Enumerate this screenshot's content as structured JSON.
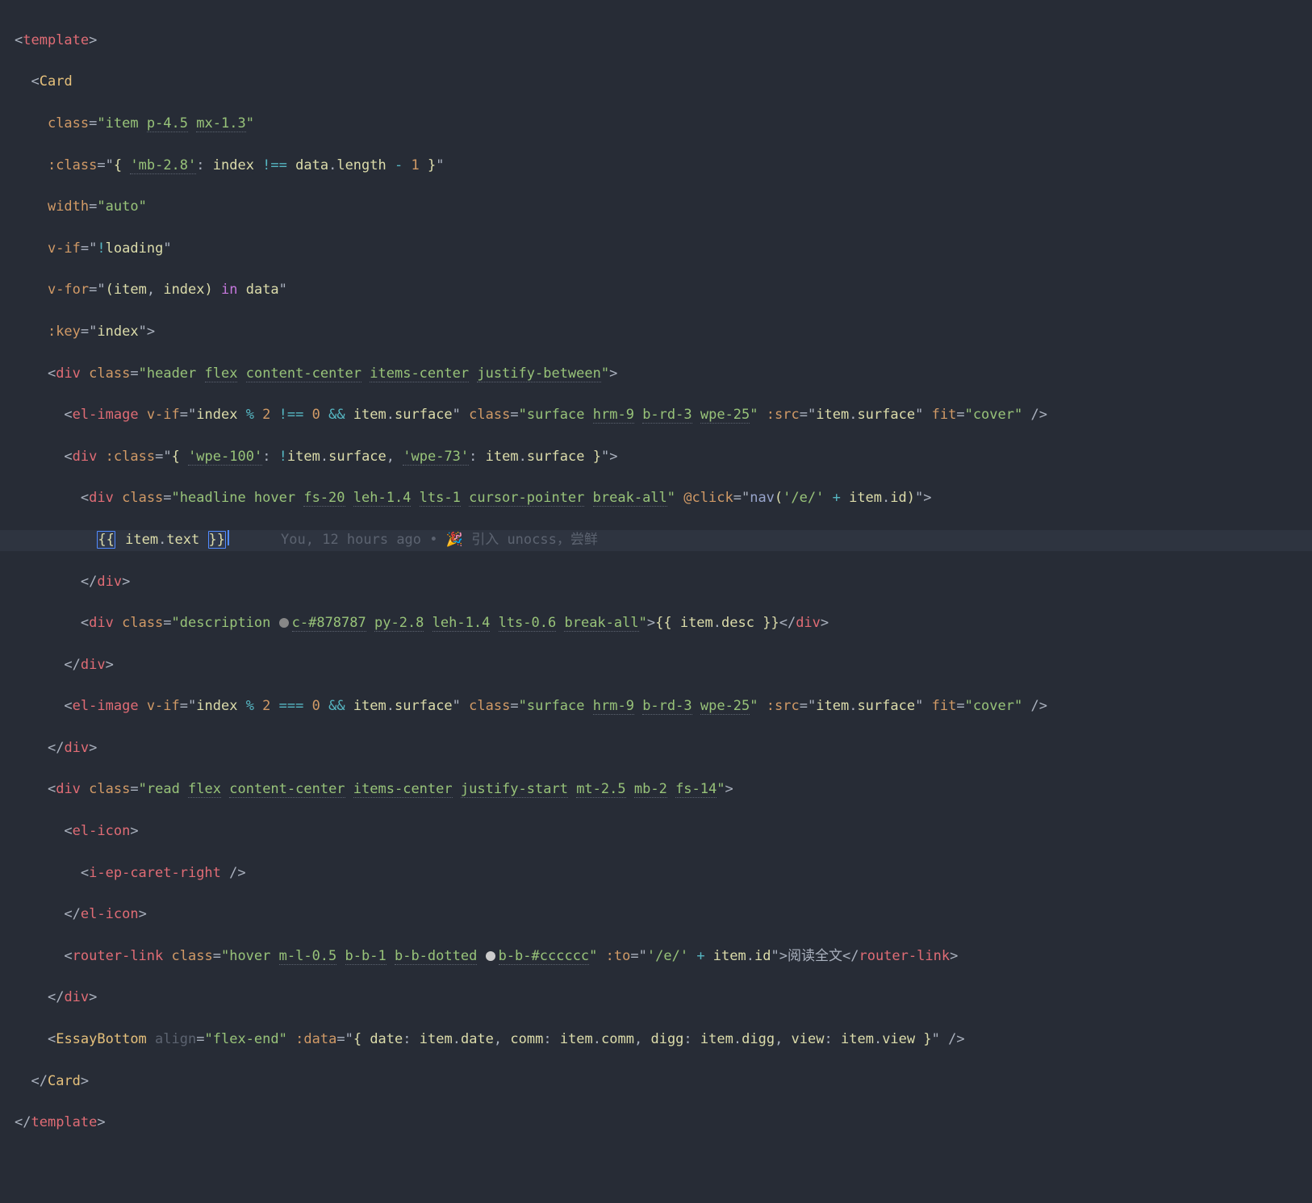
{
  "blame": {
    "author": "You",
    "when": "12 hours ago",
    "sep": "•",
    "msg": "引入 unocss，尝鲜"
  },
  "lines": {
    "l1": {
      "tag": "template"
    },
    "l2": {
      "tag": "Card"
    },
    "l3": {
      "attr": "class",
      "eq": "=",
      "q1": "\"",
      "v": "item ",
      "u1": "p-4.5",
      "sp": " ",
      "u2": "mx-1.3",
      "q2": "\""
    },
    "l4": {
      "attr": ":class",
      "eq": "=",
      "q1": "\"",
      "b1": "{",
      "sp1": " ",
      "s": "'mb-2.8'",
      "c1": ": ",
      "id": "index",
      "op": " !== ",
      "p1": "data",
      "d1": ".",
      "p2": "length",
      "op2": " - ",
      "n": "1",
      "sp2": " ",
      "b2": "}",
      "q2": "\""
    },
    "l5": {
      "attr": "width",
      "eq": "=",
      "q1": "\"",
      "v": "auto",
      "q2": "\""
    },
    "l6": {
      "attr": "v-if",
      "eq": "=",
      "q1": "\"",
      "op": "!",
      "id": "loading",
      "q2": "\""
    },
    "l7": {
      "attr": "v-for",
      "eq": "=",
      "q1": "\"",
      "p1": "(",
      "id1": "item",
      "c1": ", ",
      "id2": "index",
      "p2": ")",
      "kw": " in ",
      "id3": "data",
      "q2": "\""
    },
    "l8": {
      "attr": ":key",
      "eq": "=",
      "q1": "\"",
      "v": "index",
      "q2": "\"",
      "gt": ">"
    },
    "l9": {
      "tag": "div",
      "attr": "class",
      "eq": "=",
      "q1": "\"",
      "v": "header ",
      "u1": "flex",
      "sp1": " ",
      "u2": "content-center",
      "sp2": " ",
      "u3": "items-center",
      "sp3": " ",
      "u4": "justify-between",
      "q2": "\"",
      "gt": ">"
    },
    "l10": {
      "tag": "el-image",
      "a1": "v-if",
      "eq1": "=",
      "q1": "\"",
      "id1": "index",
      "op1": " % ",
      "n1": "2",
      "op2": " !== ",
      "n2": "0",
      "op3": " && ",
      "id2": "item",
      "d1": ".",
      "p1": "surface",
      "q2": "\"",
      "a2": "class",
      "eq2": "=",
      "q3": "\"",
      "v": "surface ",
      "u1": "hrm-9",
      "sp1": " ",
      "u2": "b-rd-3",
      "sp2": " ",
      "u3": "wpe-25",
      "q4": "\"",
      "a3": ":src",
      "eq3": "=",
      "q5": "\"",
      "id3": "item",
      "d2": ".",
      "p2": "surface",
      "q6": "\"",
      "a4": "fit",
      "eq4": "=",
      "q7": "\"",
      "v2": "cover",
      "q8": "\"",
      "slash": " />"
    },
    "l11": {
      "tag": "div",
      "a1": ":class",
      "eq1": "=",
      "q1": "\"",
      "b1": "{",
      "sp1": " ",
      "s1": "'wpe-100'",
      "c1": ": ",
      "op1": "!",
      "id1": "item",
      "d1": ".",
      "p1": "surface",
      "cm": ", ",
      "s2": "'wpe-73'",
      "c2": ": ",
      "id2": "item",
      "d2": ".",
      "p2": "surface",
      "sp2": " ",
      "b2": "}",
      "q2": "\"",
      "gt": ">"
    },
    "l12": {
      "tag": "div",
      "a1": "class",
      "eq1": "=",
      "q1": "\"",
      "v": "headline hover ",
      "u1": "fs-20",
      "sp1": " ",
      "u2": "leh-1.4",
      "sp2": " ",
      "u3": "lts-1",
      "sp3": " ",
      "u4": "cursor-pointer",
      "sp4": " ",
      "u5": "break-all",
      "q2": "\"",
      "a2": "@click",
      "eq2": "=",
      "q3": "\"",
      "fn": "nav",
      "p1": "(",
      "s1": "'/e/'",
      "op1": " + ",
      "id1": "item",
      "d1": ".",
      "pr1": "id",
      "p2": ")",
      "q4": "\"",
      "gt": ">"
    },
    "l13": {
      "mo": "{{",
      "sp1": " ",
      "id": "item",
      "d": ".",
      "p": "text",
      "sp2": " ",
      "mc": "}}"
    },
    "l14": {
      "ctag": "div"
    },
    "l15": {
      "tag": "div",
      "a1": "class",
      "eq1": "=",
      "q1": "\"",
      "v": "description ",
      "color": "c-#878787",
      "sp1": " ",
      "u1": "py-2.8",
      "sp2": " ",
      "u2": "leh-1.4",
      "sp3": " ",
      "u3": "lts-0.6",
      "sp4": " ",
      "u4": "break-all",
      "q2": "\"",
      "gt": ">",
      "mo": "{{ ",
      "id": "item",
      "d": ".",
      "p": "desc",
      "mc": " }}",
      "ctag": "div"
    },
    "l16": {
      "ctag": "div"
    },
    "l17": {
      "tag": "el-image",
      "a1": "v-if",
      "eq1": "=",
      "q1": "\"",
      "id1": "index",
      "op1": " % ",
      "n1": "2",
      "op2": " === ",
      "n2": "0",
      "op3": " && ",
      "id2": "item",
      "d1": ".",
      "p1": "surface",
      "q2": "\"",
      "a2": "class",
      "eq2": "=",
      "q3": "\"",
      "v": "surface ",
      "u1": "hrm-9",
      "sp1": " ",
      "u2": "b-rd-3",
      "sp2": " ",
      "u3": "wpe-25",
      "q4": "\"",
      "a3": ":src",
      "eq3": "=",
      "q5": "\"",
      "id3": "item",
      "d2": ".",
      "p2": "surface",
      "q6": "\"",
      "a4": "fit",
      "eq4": "=",
      "q7": "\"",
      "v2": "cover",
      "q8": "\"",
      "slash": " />"
    },
    "l18": {
      "ctag": "div"
    },
    "l19": {
      "tag": "div",
      "a1": "class",
      "eq1": "=",
      "q1": "\"",
      "v": "read ",
      "u1": "flex",
      "sp1": " ",
      "u2": "content-center",
      "sp2": " ",
      "u3": "items-center",
      "sp3": " ",
      "u4": "justify-start",
      "sp4": " ",
      "u5": "mt-2.5",
      "sp5": " ",
      "u6": "mb-2",
      "sp6": " ",
      "u7": "fs-14",
      "q2": "\"",
      "gt": ">"
    },
    "l20": {
      "tag": "el-icon",
      "gt": ">"
    },
    "l21": {
      "tag": "i-ep-caret-right",
      "slash": " />"
    },
    "l22": {
      "ctag": "el-icon"
    },
    "l23": {
      "tag": "router-link",
      "a1": "class",
      "eq1": "=",
      "q1": "\"",
      "v": "hover ",
      "u1": "m-l-0.5",
      "sp1": " ",
      "u2": "b-b-1",
      "sp2": " ",
      "u3": "b-b-dotted",
      "sp3": " ",
      "color": "b-b-#cccccc",
      "q2": "\"",
      "a2": ":to",
      "eq2": "=",
      "q3": "\"",
      "s1": "'/e/'",
      "op1": " + ",
      "id1": "item",
      "d1": ".",
      "pr1": "id",
      "q4": "\"",
      "gt": ">",
      "txt": "阅读全文",
      "ctag": "router-link"
    },
    "l24": {
      "ctag": "div"
    },
    "l25": {
      "tag": "EssayBottom",
      "a1": "align",
      "eq1": "=",
      "q1": "\"",
      "v1": "flex-end",
      "q2": "\"",
      "a2": ":data",
      "eq2": "=",
      "q3": "\"",
      "b1": "{",
      "sp1": " ",
      "k1": "date",
      "c1": ": ",
      "id1": "item",
      "d1": ".",
      "p1": "date",
      "cm1": ", ",
      "k2": "comm",
      "c2": ": ",
      "id2": "item",
      "d2": ".",
      "p2": "comm",
      "cm2": ", ",
      "k3": "digg",
      "c3": ": ",
      "id3": "item",
      "d3": ".",
      "p3": "digg",
      "cm3": ", ",
      "k4": "view",
      "c4": ": ",
      "id4": "item",
      "d4": ".",
      "p4": "view",
      "sp2": " ",
      "b2": "}",
      "q4": "\"",
      "slash": " />"
    },
    "l26": {
      "ctag": "Card"
    },
    "l27": {
      "ctag": "template"
    }
  }
}
